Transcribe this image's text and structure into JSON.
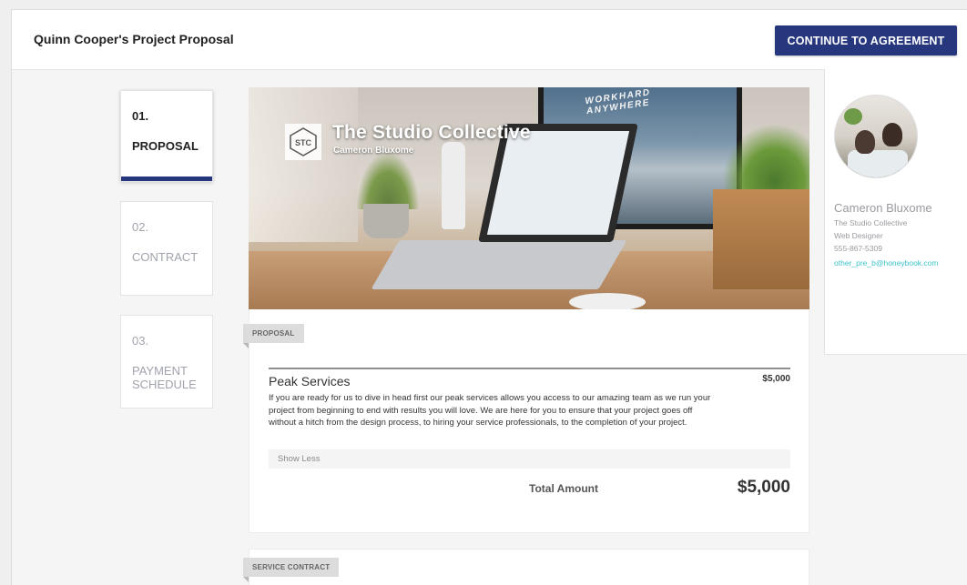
{
  "header": {
    "title": "Quinn Cooper's Project Proposal",
    "cta_label": "CONTINUE TO AGREEMENT"
  },
  "steps": [
    {
      "num": "01.",
      "label": "PROPOSAL",
      "state": "active"
    },
    {
      "num": "02.",
      "label": "CONTRACT",
      "state": "inactive"
    },
    {
      "num": "03.",
      "label": "PAYMENT SCHEDULE",
      "state": "inactive"
    }
  ],
  "hero": {
    "brand": "The Studio Collective",
    "sub": "Cameron Bluxome",
    "logo_letters": "STC",
    "monitor_text": "WORKHARD ANYWHERE"
  },
  "proposal": {
    "tag": "PROPOSAL",
    "service_name": "Peak Services",
    "service_price": "$5,000",
    "service_desc": "If you are ready for us to dive in head first our peak services allows you access to our amazing team as we run your project from beginning to end with results you will love. We are here for you to ensure that your project goes off without a hitch from the design process, to hiring your service professionals, to the completion of your project.",
    "show_less": "Show Less",
    "total_label": "Total Amount",
    "total_value": "$5,000"
  },
  "contract": {
    "tag": "SERVICE CONTRACT"
  },
  "profile": {
    "name": "Cameron Bluxome",
    "company": "The Studio Collective",
    "role": "Web Designer",
    "phone": "555-867-5309",
    "email": "other_pre_b@honeybook.com"
  },
  "colors": {
    "accent": "#27377e",
    "link": "#3cc3c9"
  }
}
